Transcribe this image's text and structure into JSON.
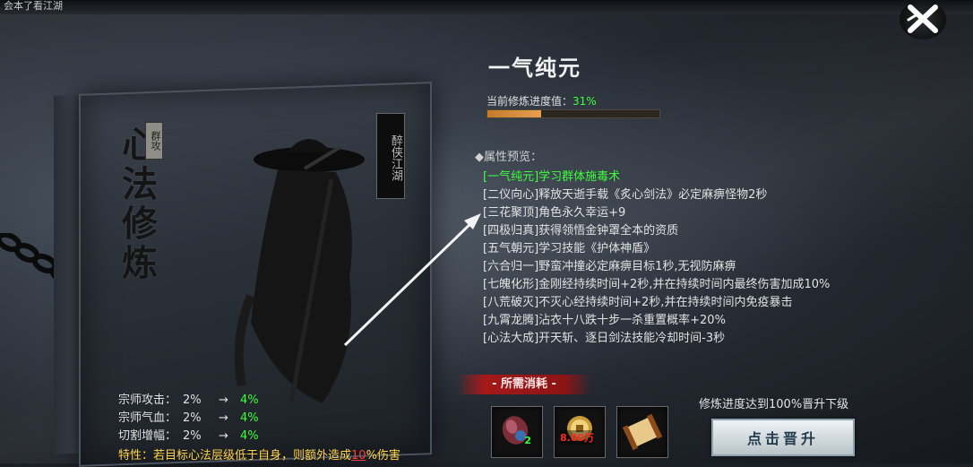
{
  "topbar": {
    "text": "会本了看江湖"
  },
  "book": {
    "title": "心法修炼",
    "subtitle": "群攻",
    "label": "醉侠江湖"
  },
  "bonuses": [
    {
      "name": "宗师攻击：",
      "from": "2%",
      "arrow": "→",
      "to": "4%"
    },
    {
      "name": "宗师气血：",
      "from": "2%",
      "arrow": "→",
      "to": "4%"
    },
    {
      "name": "切割增幅：",
      "from": "2%",
      "arrow": "→",
      "to": "4%"
    }
  ],
  "trait": {
    "prefix": "特性：若目标心法层级低于自身，则额外造成",
    "value": "10",
    "suffix": "%伤害"
  },
  "skill": {
    "name": "一气纯元",
    "progress_label": "当前修炼进度值：",
    "progress_value": "31%",
    "progress_fraction": 0.31
  },
  "attributes": {
    "title": "◆属性预览：",
    "items": [
      "[一气纯元]学习群体施毒术",
      "[二仪向心]释放天逝手载《炙心剑法》必定麻痹怪物2秒",
      "[三花聚顶]角色永久幸运+9",
      "[四极归真]获得领悟金钟罩全本的资质",
      "[五气朝元]学习技能《护体神盾》",
      "[六合归一]野蛮冲撞必定麻痹目标1秒,无视防麻痹",
      "[七魄化形]金刚经持续时间+2秒,并在持续时间内最终伤害加成10%",
      "[八荒破灭]不灭心经持续时间+2秒,并在持续时间内免疫暴击",
      "[九霄龙腾]沾衣十八跌十步一杀重置概率+20%",
      "[心法大成]开天斩、逐日剑法技能冷却时间-3秒"
    ]
  },
  "cost": {
    "title": "- 所需消耗 -",
    "items": [
      {
        "icon": "gem-icon",
        "qty": "2"
      },
      {
        "icon": "coin-icon",
        "qty": "8.00万"
      },
      {
        "icon": "scroll-icon",
        "qty": ""
      }
    ]
  },
  "hint": "修炼进度达到100%晋升下级",
  "upgrade_button": "点击晋升",
  "colors": {
    "green": "#3cff3c",
    "gold": "#ffd34a",
    "red": "#ff3a3a",
    "banner": "#a5191a"
  }
}
